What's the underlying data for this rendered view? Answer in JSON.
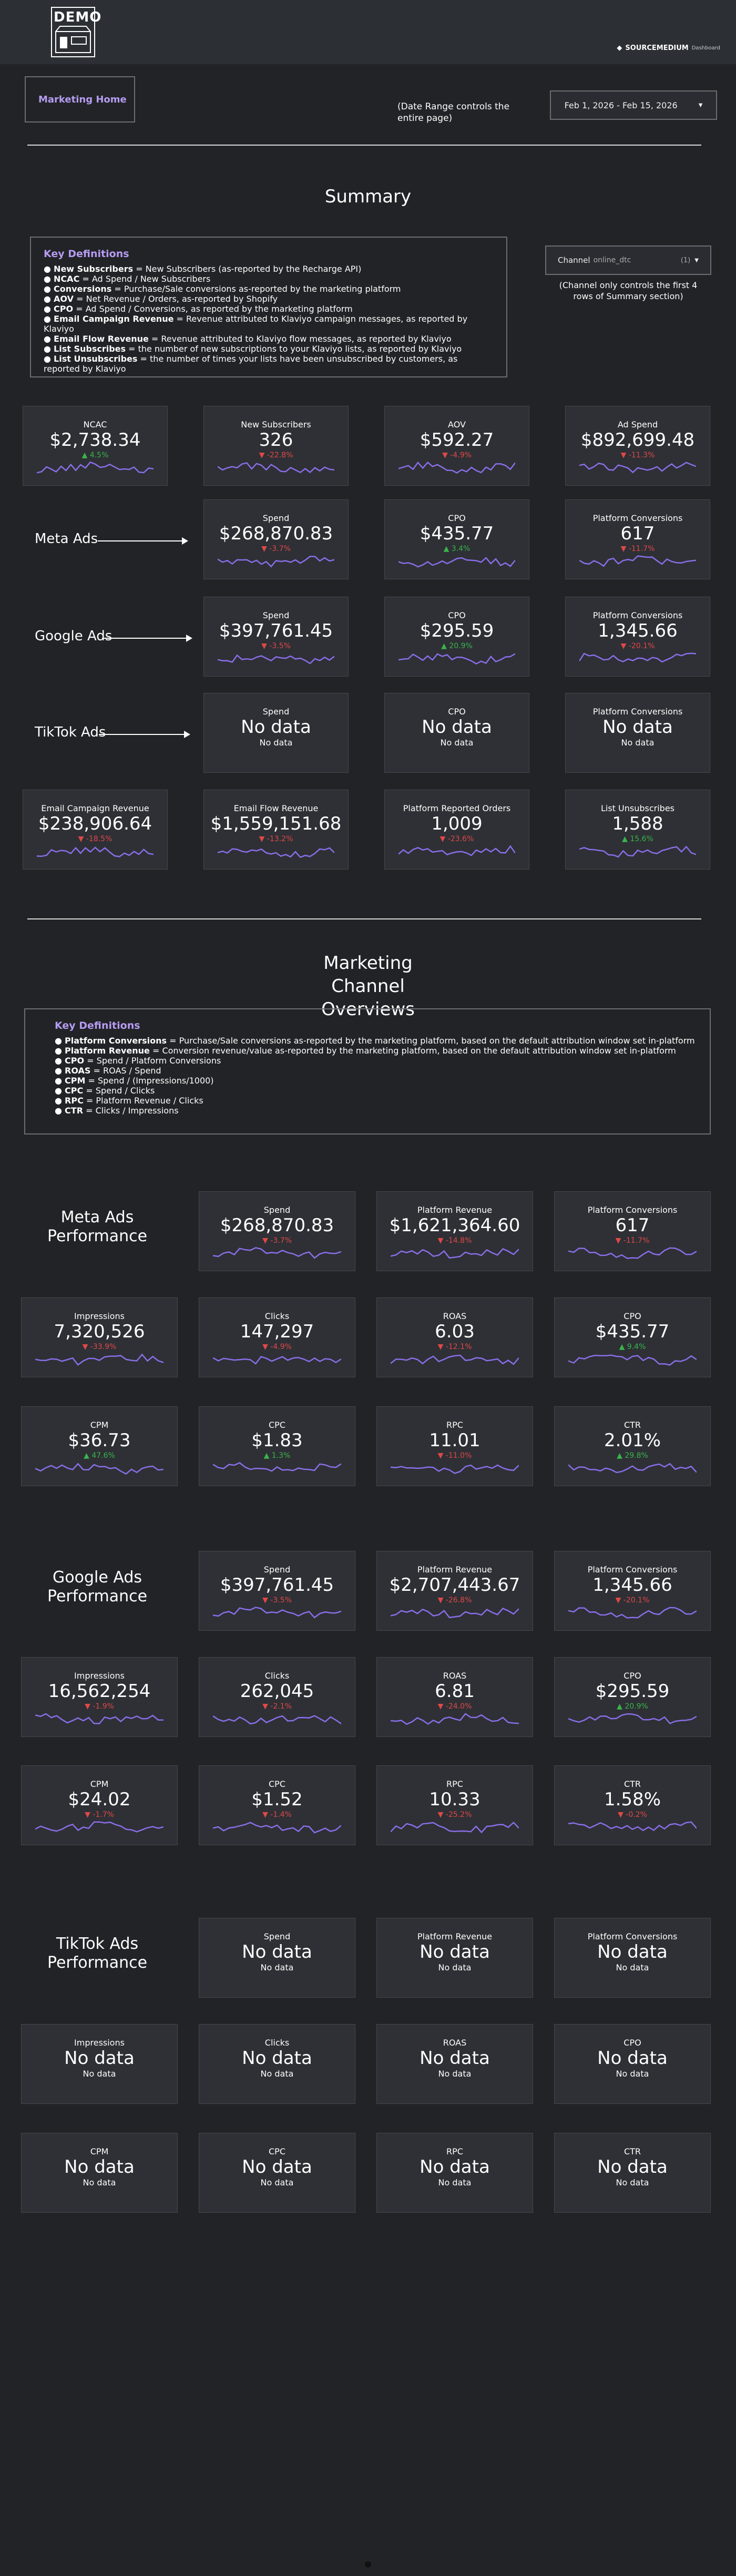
{
  "header": {
    "logo_text": "DEMO",
    "brand_name": "SOURCEMEDIUM",
    "brand_suffix": "Dashboard",
    "home_button": "Marketing Home",
    "date_note": "(Date Range controls the entire page)",
    "date_range": "Feb 1, 2026 - Feb 15, 2026"
  },
  "summary": {
    "title": "Summary",
    "defs_title": "Key Definitions",
    "defs": [
      {
        "term": "New Subscribers",
        "desc": " = New Subscribers (as-reported by the Recharge API)"
      },
      {
        "term": "NCAC",
        "desc": " = Ad Spend / New Subscribers"
      },
      {
        "term": "Conversions",
        "desc": " = Purchase/Sale conversions as-reported by the marketing platform"
      },
      {
        "term": "AOV",
        "desc": " = Net Revenue / Orders, as-reported by Shopify"
      },
      {
        "term": "CPO",
        "desc": " = Ad Spend / Conversions, as reported by the marketing platform"
      },
      {
        "term": "Email Campaign Revenue",
        "desc": " = Revenue attributed to Klaviyo campaign messages, as reported by Klaviyo"
      },
      {
        "term": "Email Flow Revenue",
        "desc": " = Revenue attributed to Klaviyo flow messages, as reported by Klaviyo"
      },
      {
        "term": "List Subscribes",
        "desc": " = the number of new subscriptions to your Klaviyo lists, as reported by Klaviyo"
      },
      {
        "term": "List Unsubscribes",
        "desc": " = the number of times your lists have been unsubscribed by customers, as reported by Klaviyo"
      }
    ],
    "channel_label": "Channel",
    "channel_value": "online_dtc",
    "channel_count": "(1)",
    "channel_note": "(Channel only controls the first 4 rows of Summary section)",
    "row_labels": [
      "Meta Ads",
      "Google Ads",
      "TikTok Ads"
    ],
    "cards": [
      {
        "label": "NCAC",
        "value": "$2,738.34",
        "change": "▲ 4.5%",
        "dir": "up"
      },
      {
        "label": "New Subscribers",
        "value": "326",
        "change": "▼ -22.8%",
        "dir": "down"
      },
      {
        "label": "AOV",
        "value": "$592.27",
        "change": "▼ -4.9%",
        "dir": "down"
      },
      {
        "label": "Ad Spend",
        "value": "$892,699.48",
        "change": "▼ -11.3%",
        "dir": "down"
      },
      {
        "label": "Spend",
        "value": "$268,870.83",
        "change": "▼ -3.7%",
        "dir": "down"
      },
      {
        "label": "CPO",
        "value": "$435.77",
        "change": "▲ 3.4%",
        "dir": "up"
      },
      {
        "label": "Platform Conversions",
        "value": "617",
        "change": "▼ -11.7%",
        "dir": "down"
      },
      {
        "label": "Spend",
        "value": "$397,761.45",
        "change": "▼ -3.5%",
        "dir": "down"
      },
      {
        "label": "CPO",
        "value": "$295.59",
        "change": "▲ 20.9%",
        "dir": "up"
      },
      {
        "label": "Platform Conversions",
        "value": "1,345.66",
        "change": "▼ -20.1%",
        "dir": "down"
      },
      {
        "label": "Spend",
        "value": "No data",
        "nodata": "No data"
      },
      {
        "label": "CPO",
        "value": "No data",
        "nodata": "No data"
      },
      {
        "label": "Platform Conversions",
        "value": "No data",
        "nodata": "No data"
      },
      {
        "label": "Email Campaign Revenue",
        "value": "$238,906.64",
        "change": "▼ -18.5%",
        "dir": "down"
      },
      {
        "label": "Email Flow Revenue",
        "value": "$1,559,151.68",
        "change": "▼ -13.2%",
        "dir": "down"
      },
      {
        "label": "Platform Reported Orders",
        "value": "1,009",
        "change": "▼ -23.6%",
        "dir": "down"
      },
      {
        "label": "List Unsubscribes",
        "value": "1,588",
        "change": "▲ 15.6%",
        "dir": "up"
      }
    ]
  },
  "channels": {
    "title": "Marketing Channel Overviews",
    "defs_title": "Key Definitions",
    "defs": [
      {
        "term": "Platform Conversions",
        "desc": " = Purchase/Sale conversions as-reported by the marketing platform, based on the default attribution window set in-platform"
      },
      {
        "term": "Platform Revenue",
        "desc": " = Conversion revenue/value as-reported by the marketing platform, based on the default attribution window set in-platform"
      },
      {
        "term": "CPO",
        "desc": " = Spend / Platform Conversions"
      },
      {
        "term": "ROAS",
        "desc": " = ROAS / Spend"
      },
      {
        "term": "CPM",
        "desc": " = Spend / (Impressions/1000)"
      },
      {
        "term": "CPC",
        "desc": " = Spend / Clicks"
      },
      {
        "term": "RPC",
        "desc": " = Platform Revenue / Clicks"
      },
      {
        "term": "CTR",
        "desc": " = Clicks / Impressions"
      }
    ],
    "meta_title": "Meta Ads Performance",
    "google_title": "Google Ads Performance",
    "tiktok_title": "TikTok Ads Performance",
    "meta": [
      {
        "label": "Spend",
        "value": "$268,870.83",
        "change": "▼ -3.7%",
        "dir": "down"
      },
      {
        "label": "Platform Revenue",
        "value": "$1,621,364.60",
        "change": "▼ -14.8%",
        "dir": "down"
      },
      {
        "label": "Platform Conversions",
        "value": "617",
        "change": "▼ -11.7%",
        "dir": "down"
      },
      {
        "label": "Impressions",
        "value": "7,320,526",
        "change": "▼ -33.9%",
        "dir": "down"
      },
      {
        "label": "Clicks",
        "value": "147,297",
        "change": "▼ -4.9%",
        "dir": "down"
      },
      {
        "label": "ROAS",
        "value": "6.03",
        "change": "▼ -12.1%",
        "dir": "down"
      },
      {
        "label": "CPO",
        "value": "$435.77",
        "change": "▲ 9.4%",
        "dir": "up"
      },
      {
        "label": "CPM",
        "value": "$36.73",
        "change": "▲ 47.6%",
        "dir": "up"
      },
      {
        "label": "CPC",
        "value": "$1.83",
        "change": "▲ 1.3%",
        "dir": "up"
      },
      {
        "label": "RPC",
        "value": "11.01",
        "change": "▼ -11.0%",
        "dir": "down"
      },
      {
        "label": "CTR",
        "value": "2.01%",
        "change": "▲ 29.8%",
        "dir": "up"
      }
    ],
    "google": [
      {
        "label": "Spend",
        "value": "$397,761.45",
        "change": "▼ -3.5%",
        "dir": "down"
      },
      {
        "label": "Platform Revenue",
        "value": "$2,707,443.67",
        "change": "▼ -26.8%",
        "dir": "down"
      },
      {
        "label": "Platform Conversions",
        "value": "1,345.66",
        "change": "▼ -20.1%",
        "dir": "down"
      },
      {
        "label": "Impressions",
        "value": "16,562,254",
        "change": "▼ -1.9%",
        "dir": "down"
      },
      {
        "label": "Clicks",
        "value": "262,045",
        "change": "▼ -2.1%",
        "dir": "down"
      },
      {
        "label": "ROAS",
        "value": "6.81",
        "change": "▼ -24.0%",
        "dir": "down"
      },
      {
        "label": "CPO",
        "value": "$295.59",
        "change": "▲ 20.9%",
        "dir": "up"
      },
      {
        "label": "CPM",
        "value": "$24.02",
        "change": "▼ -1.7%",
        "dir": "down"
      },
      {
        "label": "CPC",
        "value": "$1.52",
        "change": "▼ -1.4%",
        "dir": "down"
      },
      {
        "label": "RPC",
        "value": "10.33",
        "change": "▼ -25.2%",
        "dir": "down"
      },
      {
        "label": "CTR",
        "value": "1.58%",
        "change": "▼ -0.2%",
        "dir": "down"
      }
    ],
    "tiktok": [
      {
        "label": "Spend",
        "value": "No data",
        "nodata": "No data"
      },
      {
        "label": "Platform Revenue",
        "value": "No data",
        "nodata": "No data"
      },
      {
        "label": "Platform Conversions",
        "value": "No data",
        "nodata": "No data"
      },
      {
        "label": "Impressions",
        "value": "No data",
        "nodata": "No data"
      },
      {
        "label": "Clicks",
        "value": "No data",
        "nodata": "No data"
      },
      {
        "label": "ROAS",
        "value": "No data",
        "nodata": "No data"
      },
      {
        "label": "CPO",
        "value": "No data",
        "nodata": "No data"
      },
      {
        "label": "CPM",
        "value": "No data",
        "nodata": "No data"
      },
      {
        "label": "CPC",
        "value": "No data",
        "nodata": "No data"
      },
      {
        "label": "RPC",
        "value": "No data",
        "nodata": "No data"
      },
      {
        "label": "CTR",
        "value": "No data",
        "nodata": "No data"
      }
    ]
  },
  "colors": {
    "accent": "#b59cf2",
    "sparkline": "#8a6ee8",
    "up": "#39b54a",
    "down": "#e04848",
    "card_bg": "#2e3035"
  }
}
